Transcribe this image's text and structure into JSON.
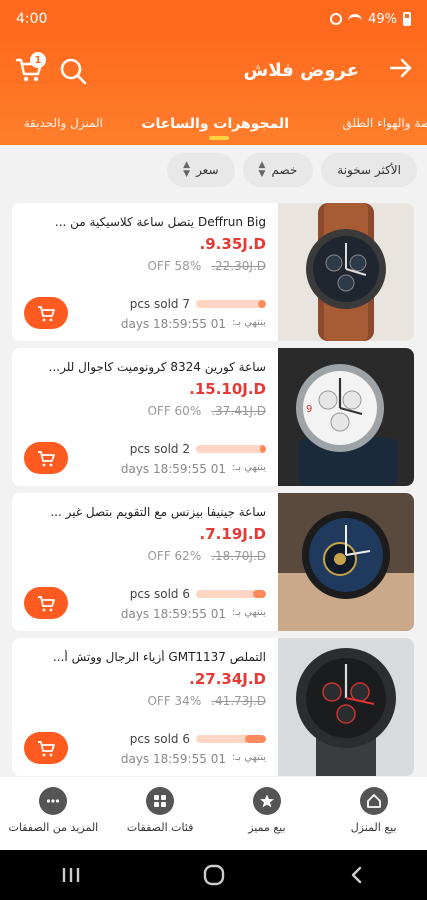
{
  "status_bar": {
    "time": "4:00",
    "battery": "49%"
  },
  "header": {
    "title": "عروض فلاش",
    "cart_badge": "1",
    "icons": {
      "back": "arrow-right-icon",
      "search": "search-icon",
      "cart": "cart-icon"
    }
  },
  "tabs": [
    {
      "label": "ضة والهواء الطلق",
      "active": false
    },
    {
      "label": "المجوهرات والساعات",
      "active": true
    },
    {
      "label": "المنزل والحديقة",
      "active": false
    }
  ],
  "filters": [
    {
      "label": "الأكثر سخونة"
    },
    {
      "label": "خصم"
    },
    {
      "label": "سعر"
    }
  ],
  "products": [
    {
      "title": "Deffrun Big يتصل ساعة كلاسيكية من ...",
      "price": ".9.35J.D",
      "old_price": ".22.30J.D",
      "discount": "OFF 58%",
      "sold": "pcs sold 7",
      "sold_fraction": 0.12,
      "timer_label": "ينتهي بـ:",
      "timer": "days 18:59:55 01"
    },
    {
      "title": "ساعة كورين 8324 كرونوميت كاجوال للر...",
      "price": ".15.10J.D",
      "old_price": ".37.41J.D",
      "discount": "OFF 60%",
      "sold": "pcs sold 2",
      "sold_fraction": 0.08,
      "timer_label": "ينتهي بـ:",
      "timer": "days 18:59:55 01"
    },
    {
      "title": "ساعة جينيفا بيزنس مع التقويم بتصل غير ...",
      "price": ".7.19J.D",
      "old_price": ".18.70J.D",
      "discount": "OFF 62%",
      "sold": "pcs sold 6",
      "sold_fraction": 0.18,
      "timer_label": "ينتهي بـ:",
      "timer": "days 18:59:55 01"
    },
    {
      "title": "التملص GMT1137 أزياء الرجال ووتش أ...",
      "price": ".27.34J.D",
      "old_price": ".41.73J.D",
      "discount": "OFF 34%",
      "sold": "pcs sold 6",
      "sold_fraction": 0.3,
      "timer_label": "ينتهي بـ:",
      "timer": "days 18:59:55 01"
    }
  ],
  "bottom_nav": [
    {
      "label": "بيع المنزل",
      "icon": "home-icon"
    },
    {
      "label": "بيع مميز",
      "icon": "star-icon"
    },
    {
      "label": "فئات الصفقات",
      "icon": "grid-icon"
    },
    {
      "label": "المزيد من الصفقات",
      "icon": "more-icon"
    }
  ],
  "colors": {
    "accent": "#ff6a1e",
    "price": "#e53935",
    "button": "#ff5a1f"
  }
}
